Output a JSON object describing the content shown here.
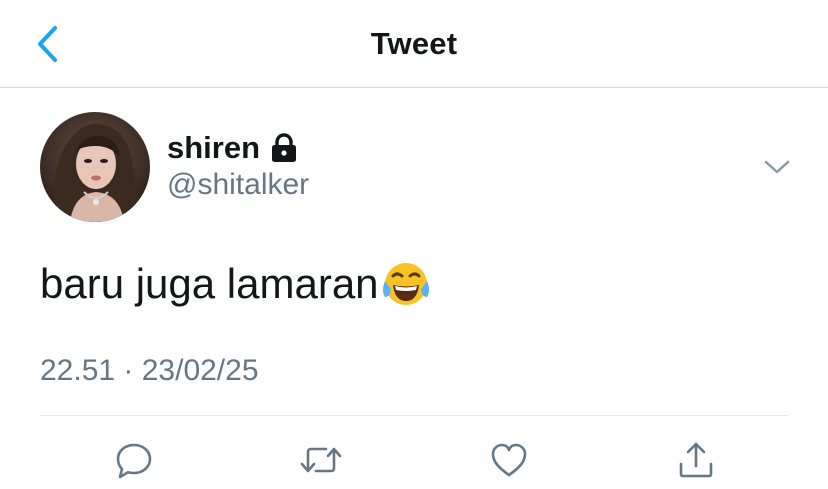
{
  "header": {
    "title": "Tweet",
    "back_icon": "chevron-left-icon",
    "accent_color": "#1da1f2"
  },
  "tweet": {
    "author": {
      "display_name": "shiren",
      "handle": "@shitalker",
      "protected_icon": "lock-icon"
    },
    "text": "baru juga lamaran",
    "emoji": "face-with-tears-of-joy",
    "timestamp": "22.51 · 23/02/25"
  },
  "actions": [
    {
      "name": "reply",
      "icon": "reply-icon"
    },
    {
      "name": "retweet",
      "icon": "retweet-icon"
    },
    {
      "name": "like",
      "icon": "heart-icon"
    },
    {
      "name": "share",
      "icon": "share-icon"
    }
  ],
  "colors": {
    "text_primary": "#14171a",
    "text_secondary": "#657786",
    "icon_gray": "#657786",
    "divider": "#e1e8ed"
  }
}
